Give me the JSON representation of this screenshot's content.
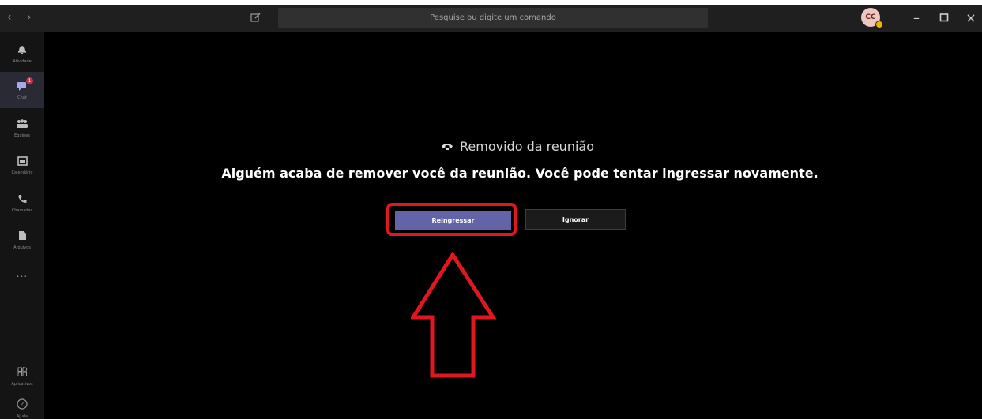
{
  "titlebar": {
    "back_glyph": "‹",
    "forward_glyph": "›",
    "search_placeholder": "Pesquise ou digite um comando",
    "avatar_initials": "CC",
    "minimize_glyph": "–",
    "maximize_glyph": "❐",
    "close_glyph": "×"
  },
  "sidebar": {
    "items": [
      {
        "label": "Atividade",
        "icon": "bell-icon",
        "glyph": "♪"
      },
      {
        "label": "Chat",
        "icon": "chat-icon",
        "glyph": "■",
        "badge": "1"
      },
      {
        "label": "Equipes",
        "icon": "teams-icon",
        "glyph": "∷"
      },
      {
        "label": "Calendário",
        "icon": "calendar-icon",
        "glyph": "▣"
      },
      {
        "label": "Chamadas",
        "icon": "phone-icon",
        "glyph": "☏"
      },
      {
        "label": "Arquivos",
        "icon": "files-icon",
        "glyph": "▤"
      }
    ],
    "more": "...",
    "bottom": [
      {
        "label": "Aplicativos",
        "icon": "apps-icon",
        "glyph": "⊞"
      },
      {
        "label": "Ajuda",
        "icon": "help-icon",
        "glyph": "?"
      }
    ]
  },
  "main": {
    "title": "Removido da reunião",
    "message": "Alguém acaba de remover você da reunião. Você pode tentar ingressar novamente.",
    "rejoin_label": "Reingressar",
    "ignore_label": "Ignorar"
  },
  "colors": {
    "accent": "#6264a7",
    "highlight": "#e0171f",
    "badge": "#c4314b"
  }
}
